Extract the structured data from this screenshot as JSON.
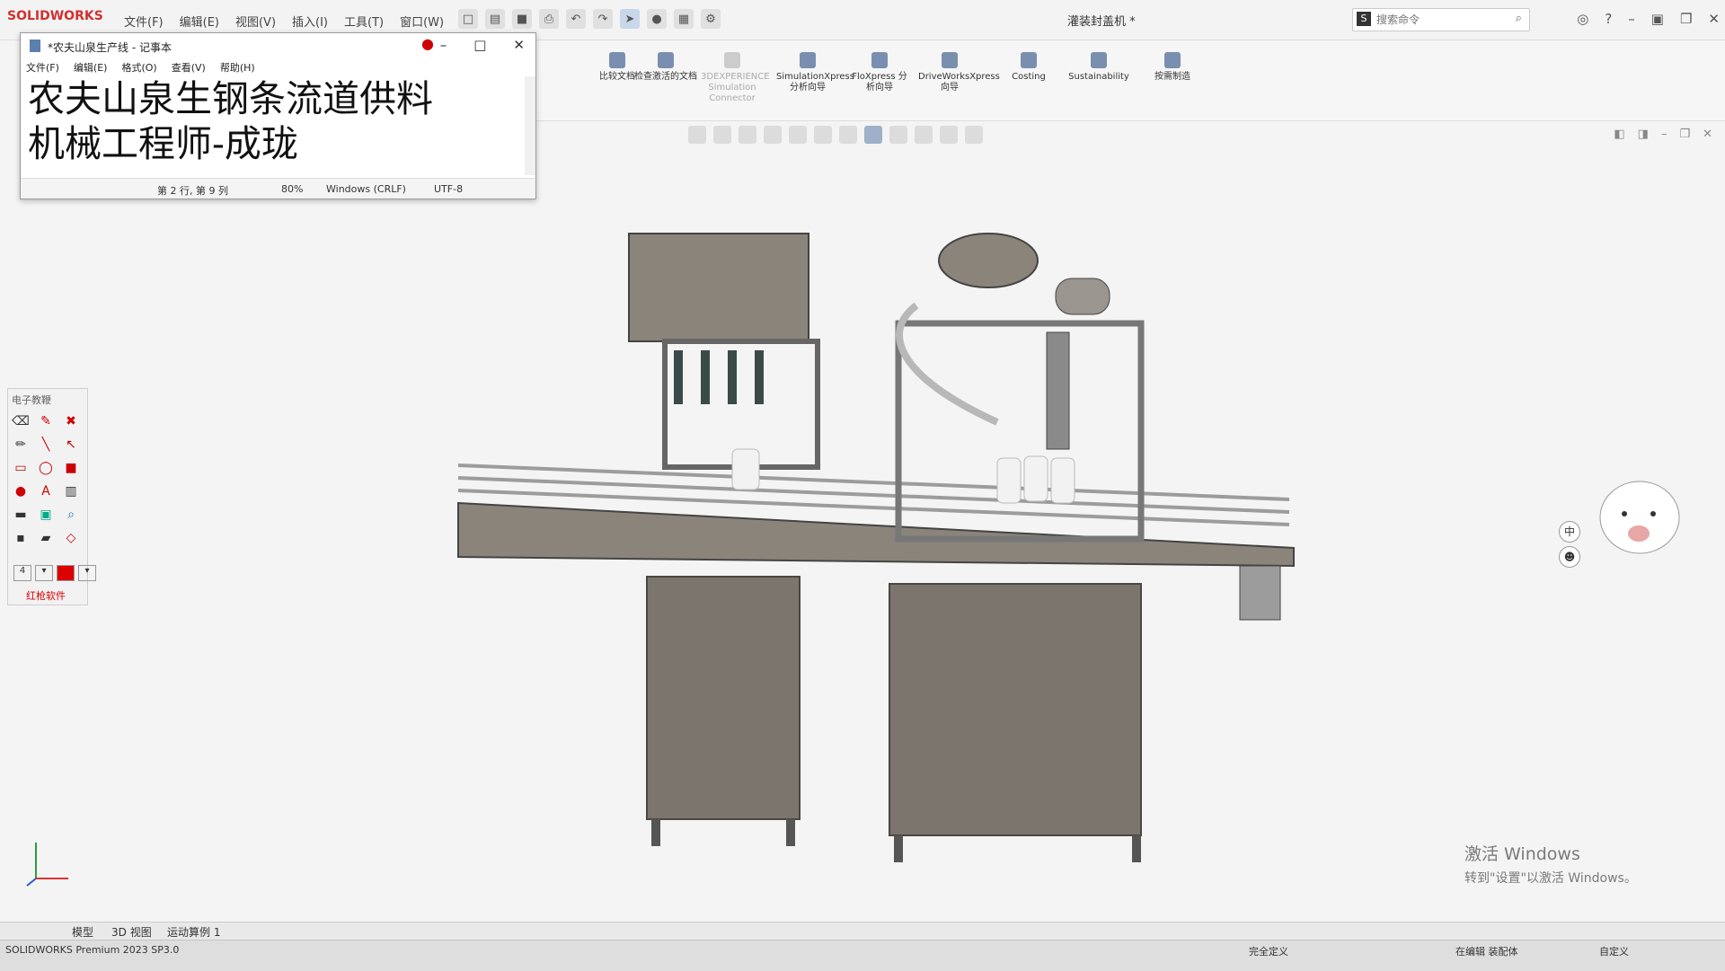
{
  "app": {
    "brand": "SOLIDWORKS",
    "menus": [
      "文件(F)",
      "编辑(E)",
      "视图(V)",
      "插入(I)",
      "工具(T)",
      "窗口(W)"
    ],
    "document_title": "灌装封盖机 *",
    "search_placeholder": "搜索命令",
    "version": "SOLIDWORKS Premium 2023 SP3.0"
  },
  "ribbon": {
    "items": [
      "比较文档",
      "检查激活的文档",
      "3DEXPERIENCE Simulation Connector",
      "SimulationXpress 分析向导",
      "FloXpress 分析向导",
      "DriveWorksXpress 向导",
      "Costing",
      "Sustainability",
      "按需制造"
    ]
  },
  "notepad": {
    "title": "*农夫山泉生产线 - 记事本",
    "menus": [
      "文件(F)",
      "编辑(E)",
      "格式(O)",
      "查看(V)",
      "帮助(H)"
    ],
    "lines": [
      "农夫山泉生钢条流道供料",
      "机械工程师-成珑"
    ],
    "status": {
      "position": "第 2 行, 第 9 列",
      "zoom": "80%",
      "line_ending": "Windows (CRLF)",
      "encoding": "UTF-8"
    }
  },
  "tools": {
    "title": "电子教鞭",
    "width_value": "4",
    "footer": "红枪软件"
  },
  "ime": {
    "lang": "中"
  },
  "tabs": [
    "模型",
    "3D 视图",
    "运动算例 1"
  ],
  "statusbar": {
    "defined": "完全定义",
    "editing": "在编辑 装配体",
    "custom": "自定义"
  },
  "activation": {
    "line1": "激活 Windows",
    "line2": "转到\"设置\"以激活 Windows。"
  },
  "colors": {
    "machine": "#7b756d",
    "accent": "#d23030"
  }
}
